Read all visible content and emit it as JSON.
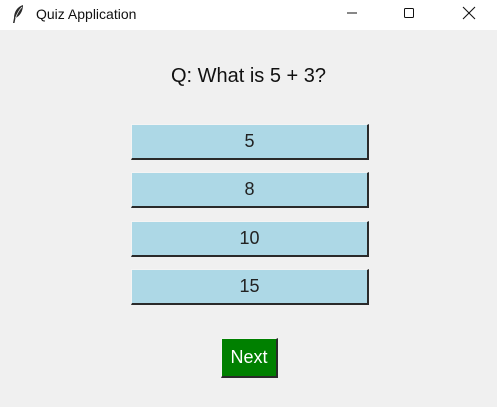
{
  "window": {
    "title": "Quiz Application",
    "icon": "feather-icon",
    "controls": [
      "minimize-icon",
      "maximize-icon",
      "close-icon"
    ]
  },
  "quiz": {
    "question": "Q: What is 5 + 3?",
    "options": [
      "5",
      "8",
      "10",
      "15"
    ],
    "next_label": "Next"
  },
  "colors": {
    "option_bg": "#add8e6",
    "next_bg": "#008000",
    "window_bg": "#f0f0f0"
  }
}
